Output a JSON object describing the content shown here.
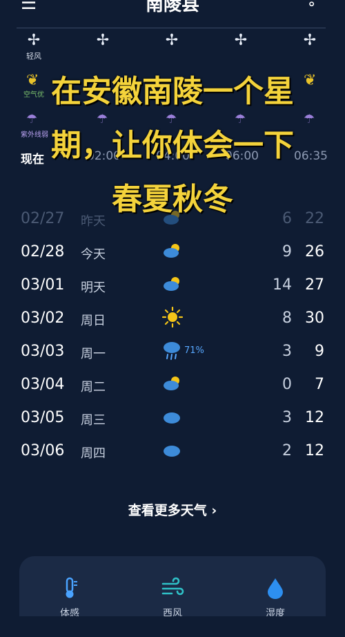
{
  "header": {
    "title": "南陵县",
    "menu_icon": "menu-add-icon",
    "more_icon": "dot-icon"
  },
  "hourly": {
    "wind_label": "轻风",
    "air_label": "空气优",
    "uv_label": "紫外线弱",
    "times": [
      "现在",
      "02:00",
      "04:00",
      "06:00",
      "06:35"
    ]
  },
  "overlay": {
    "line1": "在安徽南陵一个星",
    "line2": "期，让你体会一下",
    "line3": "春夏秋冬"
  },
  "daily": [
    {
      "date": "02/27",
      "weekday": "昨天",
      "icon": "partly-cloudy-icon",
      "low": "6",
      "high": "22",
      "past": true
    },
    {
      "date": "02/28",
      "weekday": "今天",
      "icon": "partly-cloudy-icon",
      "low": "9",
      "high": "26"
    },
    {
      "date": "03/01",
      "weekday": "明天",
      "icon": "partly-cloudy-icon",
      "low": "14",
      "high": "27"
    },
    {
      "date": "03/02",
      "weekday": "周日",
      "icon": "sunny-icon",
      "low": "8",
      "high": "30"
    },
    {
      "date": "03/03",
      "weekday": "周一",
      "icon": "rain-icon",
      "precip": "71%",
      "low": "3",
      "high": "9"
    },
    {
      "date": "03/04",
      "weekday": "周二",
      "icon": "partly-cloudy-icon",
      "low": "0",
      "high": "7"
    },
    {
      "date": "03/05",
      "weekday": "周三",
      "icon": "cloudy-icon",
      "low": "3",
      "high": "12"
    },
    {
      "date": "03/06",
      "weekday": "周四",
      "icon": "cloudy-icon",
      "low": "2",
      "high": "12"
    }
  ],
  "more_weather": "查看更多天气",
  "details": [
    {
      "label": "体感",
      "icon": "thermometer-icon"
    },
    {
      "label": "西风",
      "icon": "wind-icon"
    },
    {
      "label": "湿度",
      "icon": "humidity-icon"
    }
  ],
  "colors": {
    "background": "#0f1c33",
    "overlay_text": "#f4d33b",
    "precip": "#58a8ff",
    "sun": "#f5c518"
  }
}
